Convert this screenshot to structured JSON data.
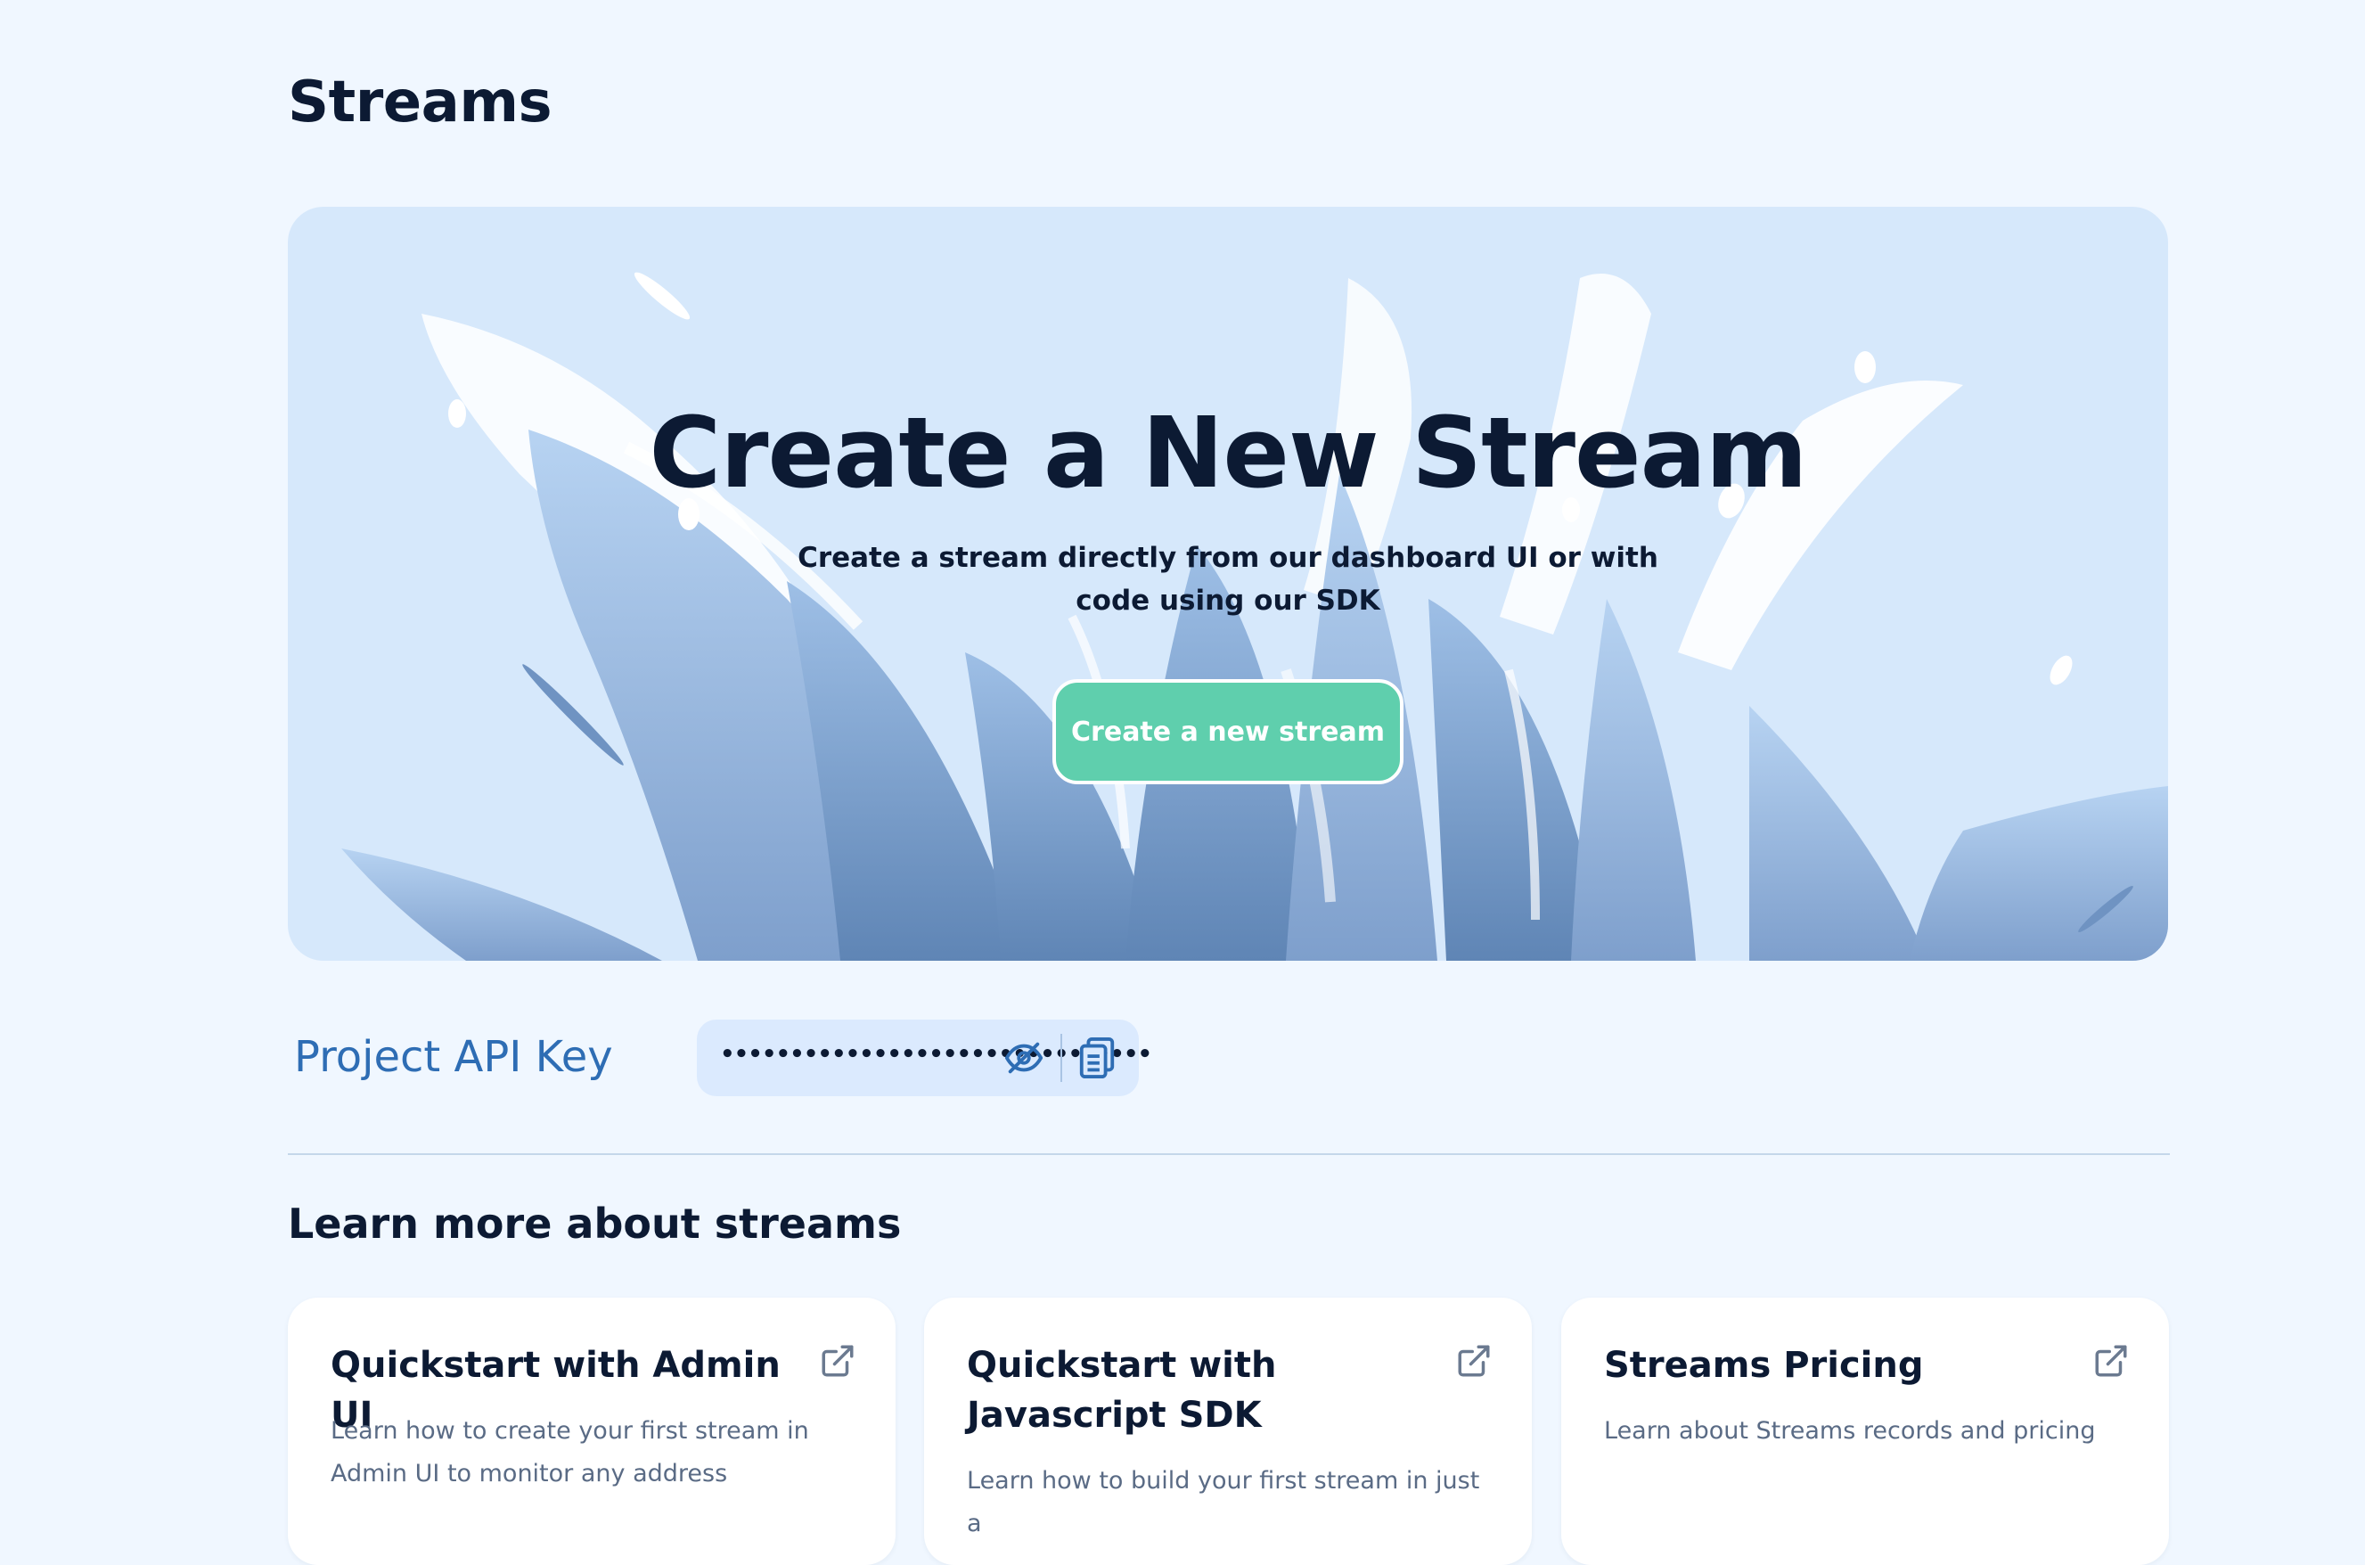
{
  "page": {
    "title": "Streams"
  },
  "hero": {
    "title": "Create a New Stream",
    "subtitle": "Create a stream directly from our dashboard UI or with code using our SDK",
    "cta_label": "Create a new stream"
  },
  "api_key": {
    "label": "Project API Key",
    "masked_value": "•••••••••••••••••••••••••••••••",
    "toggle_icon": "eye-off-icon",
    "copy_icon": "copy-icon"
  },
  "learn": {
    "title": "Learn more about streams",
    "cards": [
      {
        "title": "Quickstart with Admin UI",
        "description": "Learn how to create your first stream in Admin UI to monitor any address",
        "icon": "external-link-icon"
      },
      {
        "title": "Quickstart with Javascript SDK",
        "description": "Learn how to build your first stream in just a",
        "icon": "external-link-icon"
      },
      {
        "title": "Streams Pricing",
        "description": "Learn about Streams records and pricing",
        "icon": "external-link-icon"
      }
    ]
  },
  "colors": {
    "background": "#f0f7ff",
    "hero_background": "#d6e8fb",
    "cta": "#5fcfad",
    "api_label": "#2e6db4",
    "text_dark": "#0c1a33"
  }
}
